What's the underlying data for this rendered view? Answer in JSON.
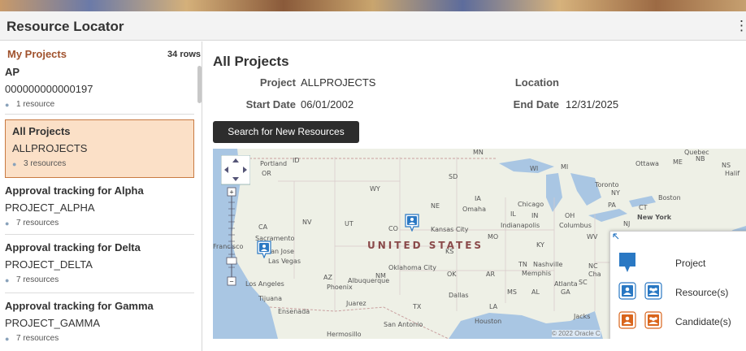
{
  "app": {
    "title": "Resource Locator",
    "menu_icon": "more-vertical-icon"
  },
  "left_pane": {
    "heading": "My Projects",
    "rows_count": "34 rows",
    "items": [
      {
        "name": "AP",
        "code": "000000000000197",
        "resources": "1 resource"
      },
      {
        "name": "All Projects",
        "code": "ALLPROJECTS",
        "resources": "3 resources"
      },
      {
        "name": "Approval tracking for Alpha",
        "code": "PROJECT_ALPHA",
        "resources": "7 resources"
      },
      {
        "name": "Approval tracking for Delta",
        "code": "PROJECT_DELTA",
        "resources": "7 resources"
      },
      {
        "name": "Approval tracking for Gamma",
        "code": "PROJECT_GAMMA",
        "resources": "7 resources"
      }
    ]
  },
  "main": {
    "title": "All Projects",
    "project_label": "Project",
    "project_value": "ALLPROJECTS",
    "location_label": "Location",
    "location_value": "",
    "start_label": "Start Date",
    "start_value": "06/01/2002",
    "end_label": "End Date",
    "end_value": "12/31/2025",
    "search_button": "Search for New Resources"
  },
  "map": {
    "country_label": "UNITED STATES",
    "copyright": "© 2022 Oracle C",
    "labels": {
      "portland": "Portland",
      "or": "OR",
      "id": "ID",
      "sd": "SD",
      "wy": "WY",
      "ne": "NE",
      "ia": "IA",
      "omaha": "Omaha",
      "chicago": "Chicago",
      "il": "IL",
      "in": "IN",
      "oh": "OH",
      "pa": "PA",
      "ct": "CT",
      "new_york": "New York",
      "boston": "Boston",
      "toronto": "Toronto",
      "ny": "NY",
      "ottawa": "Ottawa",
      "me": "ME",
      "nb": "NB",
      "ns": "NS",
      "halifax": "Halif",
      "quebec": "Quebec",
      "wi": "WI",
      "mi": "MI",
      "mn": "MN",
      "nv": "NV",
      "ut": "UT",
      "co": "CO",
      "ca": "CA",
      "kansas_city": "Kansas City",
      "ks": "KS",
      "mo": "MO",
      "indianapolis": "Indianapolis",
      "columbus": "Columbus",
      "wv": "WV",
      "ky": "KY",
      "nj": "NJ",
      "sacramento": "Sacramento",
      "san_francisco": "Francisco",
      "san_jose": "San Jose",
      "las_vegas": "Las Vegas",
      "los_angeles": "Los Angeles",
      "phoenix": "Phoenix",
      "az": "AZ",
      "nm": "NM",
      "albuquerque": "Albuquerque",
      "oklahoma_city": "Oklahoma City",
      "ok": "OK",
      "ar": "AR",
      "tn": "TN",
      "nashville": "Nashville",
      "memphis": "Memphis",
      "nc": "NC",
      "cha": "Cha",
      "sc": "SC",
      "atlanta": "Atlanta",
      "ga": "GA",
      "ms": "MS",
      "al": "AL",
      "dallas": "Dallas",
      "tx": "TX",
      "la": "LA",
      "houston": "Houston",
      "san_antonio": "San Antonio",
      "juarez": "Juarez",
      "tijuana": "Tijuana",
      "ensenada": "Ensenada",
      "hermosillo": "Hermosillo",
      "jacks": "Jacks"
    }
  },
  "legend": {
    "project": "Project",
    "resources": "Resource(s)",
    "candidates": "Candidate(s)"
  },
  "colors": {
    "accent": "#a0522d",
    "selected_bg": "#fbe0c7",
    "pin_blue": "#2a78c3",
    "pin_orange": "#d9651c"
  }
}
